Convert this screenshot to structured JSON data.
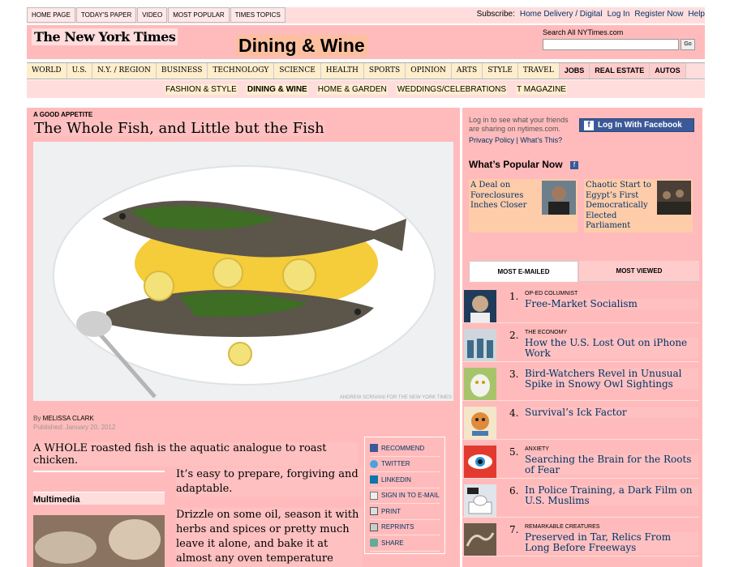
{
  "top_nav": [
    "HOME PAGE",
    "TODAY'S PAPER",
    "VIDEO",
    "MOST POPULAR",
    "TIMES TOPICS"
  ],
  "top_right": {
    "subscribe_label": "Subscribe:",
    "home_delivery": "Home Delivery / Digital",
    "log_in": "Log In",
    "register": "Register Now",
    "help": "Help"
  },
  "masthead": {
    "logo": "The New York Times",
    "section": "Dining & Wine",
    "search_label": "Search All NYTimes.com",
    "search_button": "Go"
  },
  "main_nav": [
    "WORLD",
    "U.S.",
    "N.Y. / REGION",
    "BUSINESS",
    "TECHNOLOGY",
    "SCIENCE",
    "HEALTH",
    "SPORTS",
    "OPINION",
    "ARTS",
    "STYLE",
    "TRAVEL",
    "JOBS",
    "REAL ESTATE",
    "AUTOS"
  ],
  "sub_nav": [
    "FASHION & STYLE",
    "DINING & WINE",
    "HOME & GARDEN",
    "WEDDINGS/CELEBRATIONS",
    "T MAGAZINE"
  ],
  "article": {
    "kicker": "A GOOD APPETITE",
    "headline": "The Whole Fish, and Little but the Fish",
    "photo_credit": "ANDREW SCRIVANI FOR THE NEW YORK TIMES",
    "byline_prefix": "By",
    "author": "MELISSA CLARK",
    "published": "Published: January 20, 2012",
    "lede": "A WHOLE roasted fish is the aquatic analogue to roast chicken.",
    "para1": "It’s easy to prepare, forgiving and adaptable.",
    "para2": "Drizzle on some oil, season it with herbs and spices or pretty much leave it alone, and bake it at almost any oven temperature along with",
    "multimedia": "Multimedia"
  },
  "tools": [
    "RECOMMEND",
    "TWITTER",
    "LINKEDIN",
    "SIGN IN TO E-MAIL",
    "PRINT",
    "REPRINTS",
    "SHARE"
  ],
  "facebook": {
    "text": "Log in to see what your friends are sharing on nytimes.com.",
    "privacy": "Privacy Policy",
    "sep": "|",
    "whats_this": "What’s This?",
    "button": "Log In With Facebook"
  },
  "whats_popular": {
    "title": "What’s Popular Now",
    "items": [
      "A Deal on Foreclosures Inches Closer",
      "Chaotic Start to Egypt’s First Democratically Elected Parliament"
    ]
  },
  "tabs": {
    "active": "MOST E-MAILED",
    "inactive": "MOST VIEWED"
  },
  "most_emailed": [
    {
      "num": "1.",
      "tag": "OP-ED COLUMNIST",
      "title": "Free-Market Socialism"
    },
    {
      "num": "2.",
      "tag": "THE ECONOMY",
      "title": "How the U.S. Lost Out on iPhone Work"
    },
    {
      "num": "3.",
      "tag": "",
      "title": "Bird-Watchers Revel in Unusual Spike in Snowy Owl Sightings"
    },
    {
      "num": "4.",
      "tag": "",
      "title": "Survival’s Ick Factor"
    },
    {
      "num": "5.",
      "tag": "ANXIETY",
      "title": "Searching the Brain for the Roots of Fear"
    },
    {
      "num": "6.",
      "tag": "",
      "title": "In Police Training, a Dark Film on U.S. Muslims"
    },
    {
      "num": "7.",
      "tag": "REMARKABLE CREATURES",
      "title": "Preserved in Tar, Relics From Long Before Freeways"
    }
  ]
}
